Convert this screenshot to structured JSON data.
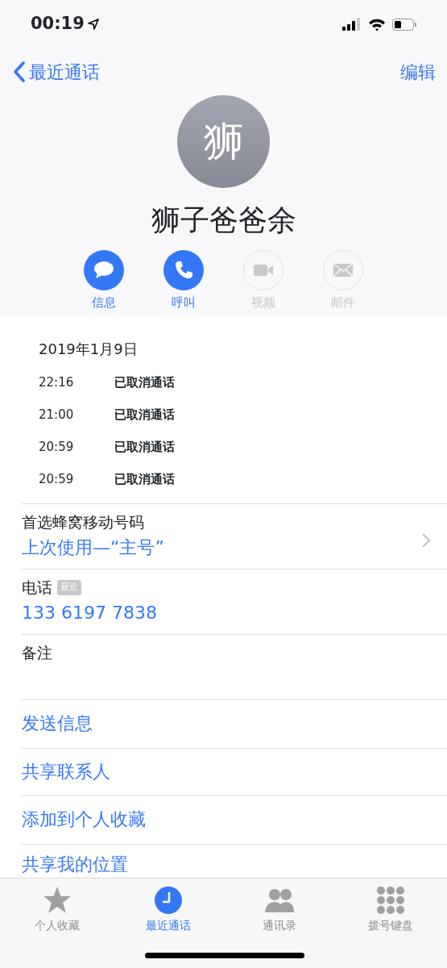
{
  "status_bar": {
    "time": "00:19"
  },
  "nav": {
    "back": "最近通话",
    "edit": "编辑"
  },
  "contact": {
    "initial": "狮",
    "name": "狮子爸爸余"
  },
  "actions": [
    {
      "kind": "message",
      "label": "信息",
      "enabled": true
    },
    {
      "kind": "call",
      "label": "呼叫",
      "enabled": true
    },
    {
      "kind": "video",
      "label": "视频",
      "enabled": false
    },
    {
      "kind": "mail",
      "label": "邮件",
      "enabled": false
    }
  ],
  "call_log": {
    "date": "2019年1月9日",
    "entries": [
      {
        "time": "22:16",
        "status": "已取消通话"
      },
      {
        "time": "21:00",
        "status": "已取消通话"
      },
      {
        "time": "20:59",
        "status": "已取消通话"
      },
      {
        "time": "20:59",
        "status": "已取消通话"
      }
    ]
  },
  "fields": [
    {
      "label": "首选蜂窝移动号码",
      "value": "上次使用—“主号”",
      "chevron": true
    },
    {
      "label": "电话",
      "badge": "最近",
      "value": "133 6197 7838",
      "chevron": false
    },
    {
      "label": "备注",
      "chevron": false
    }
  ],
  "links": [
    "发送信息",
    "共享联系人",
    "添加到个人收藏",
    "共享我的位置"
  ],
  "tab_bar": [
    {
      "kind": "star",
      "label": "个人收藏",
      "selected": false
    },
    {
      "kind": "clock",
      "label": "最近通话",
      "selected": true
    },
    {
      "kind": "people",
      "label": "通讯录",
      "selected": false
    },
    {
      "kind": "keypad",
      "label": "拨号键盘",
      "selected": false
    }
  ]
}
